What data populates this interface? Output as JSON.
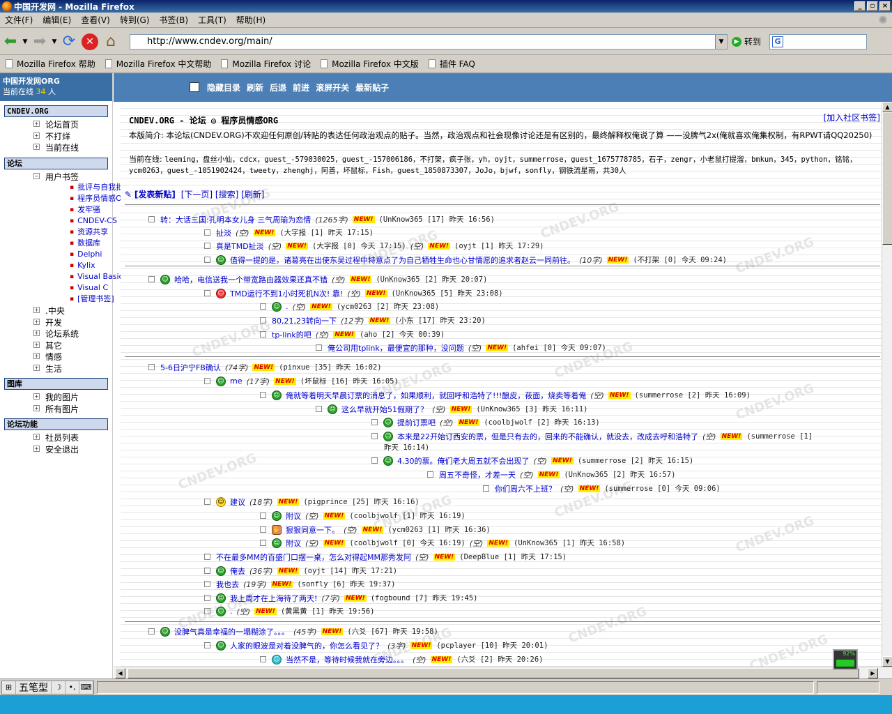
{
  "window": {
    "title": "中国开发网 - Mozilla Firefox",
    "controls": [
      "_",
      "▫",
      "×"
    ]
  },
  "menubar": [
    "文件(F)",
    "编辑(E)",
    "查看(V)",
    "转到(G)",
    "书签(B)",
    "工具(T)",
    "帮助(H)"
  ],
  "navbar": {
    "url": "http://www.cndev.org/main/",
    "go_label": "转到"
  },
  "bookmarks": [
    "Mozilla Firefox 帮助",
    "Mozilla Firefox 中文帮助",
    "Mozilla Firefox 讨论",
    "Mozilla Firefox 中文版",
    "插件 FAQ"
  ],
  "left": {
    "site_name": "中国开发网ORG",
    "online_prefix": "当前在线",
    "online_count": "34",
    "online_suffix": "人",
    "sec1": "CNDEV.ORG",
    "sec1_items": [
      "论坛首页",
      "不打烊",
      "当前在线"
    ],
    "sec2": "论坛",
    "user_bookmarks": "用户书签",
    "sub_items": [
      "批评与自我批评",
      "程序员情感ORG",
      "发牢骚",
      "CNDEV-CS",
      "资源共享",
      "数据库",
      "Delphi",
      "Kylix",
      "Visual Basic",
      "Visual C",
      "[管理书签]"
    ],
    "forum_items": [
      ".中央",
      "开发",
      "论坛系统",
      "其它",
      "情感",
      "生活"
    ],
    "sec3": "图库",
    "gallery_items": [
      "我的图片",
      "所有图片"
    ],
    "sec4": "论坛功能",
    "func_items": [
      "社员列表",
      "安全退出"
    ]
  },
  "topbar": [
    "隐藏目录",
    "刷新",
    "后退",
    "前进",
    "滚屏开关",
    "最新贴子"
  ],
  "forum": {
    "title": "CNDEV.ORG - 论坛 ◎ 程序员情感ORG",
    "add_bookmark": "[加入社区书签]",
    "intro_label": "本版简介:",
    "intro": "本论坛(CNDEV.ORG)不欢迎任何原创/转贴的表达任何政治观点的贴子。当然，政治观点和社会现像讨论还是有区别的，最终解释权俺说了算 ——没脾气2x(俺就喜欢俺集权制，有RPWT请QQ20250)",
    "online_label": "当前在线:",
    "online_users": "leeming，盘丝小仙，cdcx，guest_-579030025，guest_-157006186，不打架，疯子张，yh，oyjt，summerrose，guest_1675778785，石子，zengr，小老鼠打提溜，bmkun，345，python，铭铭，ycm0263，guest_-1051902424，tweety，zhenghj，阿善，坏鼠标，Fish，guest_1850873307，JoJo，bjwf，sonfly，钢铁流星雨，共30人",
    "actions": [
      "[发表新贴]",
      "[下一页]",
      "[搜索]",
      "[刷新]"
    ]
  },
  "posts": [
    {
      "title": "转：大话三国:孔明本女儿身 三气周瑜为恋情",
      "len": "(1265字)",
      "meta": "(UnKnow365 [17] 昨天 16:56)",
      "face": ""
    },
    {
      "title": "扯淡",
      "len": "(空)",
      "meta": "(大字报 [1] 昨天 17:15)",
      "face": ""
    },
    {
      "title": "真是TMD扯淡",
      "len": "(空)",
      "meta": "(大字报 [0] 今天 17:15)",
      "extra": "(空)",
      "meta2": "(oyjt [1] 昨天 17:29)",
      "face": ""
    },
    {
      "title": "值得一提的是，诸葛亮在出使东吴过程中特意点了为自己牺牲生命也心甘情愿的追求者赵云一同前往。",
      "len": "(10字)",
      "meta": "(不打架 [0] 今天 09:24)",
      "face": "green"
    },
    {
      "title": "哈哈，电信送我一个带宽路由器效果还真不错",
      "len": "(空)",
      "meta": "(UnKnow365 [2] 昨天 20:07)",
      "face": "green"
    },
    {
      "title": "TMD运行不到1小时死机N次! 靠!",
      "len": "(空)",
      "meta": "(UnKnow365 [5] 昨天 23:08)",
      "face": "red"
    },
    {
      "title": ".",
      "len": "(空)",
      "meta": "(ycm0263 [2] 昨天 23:08)",
      "face": "green"
    },
    {
      "title": "80,21,23转向一下",
      "len": "(12字)",
      "meta": "(小东 [17] 昨天 23:20)",
      "face": ""
    },
    {
      "title": "tp-link的吧",
      "len": "(空)",
      "meta": "(aho [2] 今天 00:39)",
      "face": ""
    },
    {
      "title": "俺公司用tplink，最便宜的那种，没问题",
      "len": "(空)",
      "meta": "(ahfei [0] 今天 09:07)",
      "face": ""
    },
    {
      "title": "5-6日沪宁FB确认",
      "len": "(74字)",
      "meta": "(pinxue [35] 昨天 16:02)",
      "face": ""
    },
    {
      "title": "me",
      "len": "(17字)",
      "meta": "(坏鼠标 [16] 昨天 16:05)",
      "face": "green"
    },
    {
      "title": "俺就等着明天早晨订票的消息了，如果顺利，就回呼和浩特了!!!酿皮，莜面，烧卖等着俺",
      "len": "(空)",
      "meta": "(summerrose [2] 昨天 16:09)",
      "face": "green"
    },
    {
      "title": "这么早就开始51假期了？",
      "len": "(空)",
      "meta": "(UnKnow365 [3] 昨天 16:11)",
      "face": "green"
    },
    {
      "title": "提前订票吧",
      "len": "(空)",
      "meta": "(coolbjwolf [2] 昨天 16:13)",
      "face": "green"
    },
    {
      "title": "本来是22开始订西安的票，但是只有去的，回来的不能确认，就没去，改成去呼和浩特了",
      "len": "(空)",
      "meta": "(summerrose [1]",
      "meta_cont": "昨天 16:14)",
      "face": "green"
    },
    {
      "title": "4.30的票。俺们老大周五就不会出现了",
      "len": "(空)",
      "meta": "(summerrose [2] 昨天 16:15)",
      "face": "green"
    },
    {
      "title": "周五不奇怪，才差一天",
      "len": "(空)",
      "meta": "(UnKnow365 [2] 昨天 16:57)",
      "face": ""
    },
    {
      "title": "你们周六不上班？",
      "len": "(空)",
      "meta": "(summerrose [0] 今天 09:06)",
      "face": ""
    },
    {
      "title": "建议",
      "len": "(18字)",
      "meta": "(pigprince [25] 昨天 16:16)",
      "face": "yellow"
    },
    {
      "title": "附议",
      "len": "(空)",
      "meta": "(coolbjwolf [1] 昨天 16:19)",
      "face": "green"
    },
    {
      "title": "狠狠同意一下。",
      "len": "(空)",
      "meta": "(ycm0263 [1] 昨天 16:36)",
      "face": "hand"
    },
    {
      "title": "附议",
      "len": "(空)",
      "meta": "(coolbjwolf [0] 今天 16:19)",
      "extra": "(空)",
      "meta2": "(UnKnow365 [1] 昨天 16:58)",
      "face": "green"
    },
    {
      "title": "不在最多MM的百盛门口摆一桌，怎么对得起MM那秀发阿",
      "len": "(空)",
      "meta": "(DeepBlue [1] 昨天 17:15)",
      "face": ""
    },
    {
      "title": "俺去",
      "len": "(36字)",
      "meta": "(oyjt [14] 昨天 17:21)",
      "face": "green"
    },
    {
      "title": "我也去",
      "len": "(19字)",
      "meta": "(sonfly [6] 昨天 19:37)",
      "face": ""
    },
    {
      "title": "我上周才在上海待了两天!",
      "len": "(7字)",
      "meta": "(fogbound [7] 昨天 19:45)",
      "face": "green"
    },
    {
      "title": ".",
      "len": "(空)",
      "meta": "(黄黑黄 [1] 昨天 19:56)",
      "face": "green"
    },
    {
      "title": "没脾气真是幸福的一塌糊涂了。。。",
      "len": "(45字)",
      "meta": "(六爻 [67] 昨天 19:58)",
      "face": "green"
    },
    {
      "title": "人家的眼波是对着没脾气的，你怎么看见了？",
      "len": "(3字)",
      "meta": "(pcplayer [10] 昨天 20:01)",
      "face": "green"
    },
    {
      "title": "当然不是，等待时候我就在旁边。。。",
      "len": "(空)",
      "meta": "(六爻 [2] 昨天 20:26)",
      "face": "cyan"
    }
  ],
  "new_badge": "NEW!",
  "watermark": "CNDEV.ORG",
  "gadget_value": "92%",
  "statusbar": {
    "ime_label": "五笔型"
  },
  "colors": {
    "titlebar": "#0a246a",
    "left_header": "#3a6fa5",
    "topbar": "#4b7fb5",
    "link": "#0000cc",
    "new_badge_bg": "#ffec00",
    "taskbar": "#1c9fd4"
  }
}
